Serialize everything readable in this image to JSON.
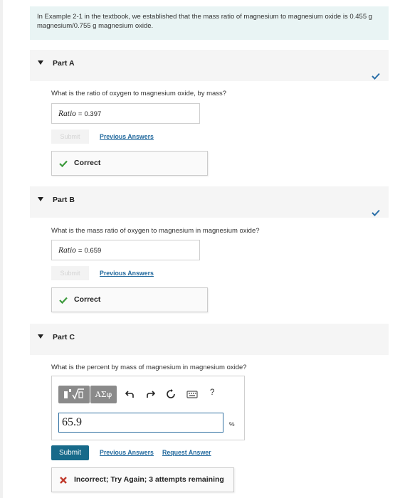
{
  "intro_text": "In Example 2-1 in the textbook, we established that the mass ratio of magnesium to magnesium oxide is 0.455 g magnesium/0.755 g magnesium oxide.",
  "colors": {
    "accent": "#176a8a",
    "link": "#236a9e",
    "correct": "#3c9a3c",
    "incorrect": "#c0392b",
    "check": "#2a6fa8"
  },
  "part_a": {
    "title": "Part A",
    "question": "What is the ratio of oxygen to magnesium oxide, by mass?",
    "answer_var": "Ratio",
    "answer_eq": "=",
    "answer_value": "0.397",
    "submit_label": "Submit",
    "previous_answers_label": "Previous Answers",
    "feedback": "Correct"
  },
  "part_b": {
    "title": "Part B",
    "question": "What is the mass ratio of oxygen to magnesium in magnesium oxide?",
    "answer_var": "Ratio",
    "answer_eq": "=",
    "answer_value": "0.659",
    "submit_label": "Submit",
    "previous_answers_label": "Previous Answers",
    "feedback": "Correct"
  },
  "part_c": {
    "title": "Part C",
    "question": "What is the percent by mass of magnesium in magnesium oxide?",
    "toolbar": {
      "templates_icon": "math-templates-icon",
      "symbols_label": "ΑΣφ",
      "undo_icon": "undo-icon",
      "redo_icon": "redo-icon",
      "reset_icon": "reset-icon",
      "keyboard_icon": "keyboard-icon",
      "help_label": "?"
    },
    "input_value": "65.9",
    "unit": "%",
    "submit_label": "Submit",
    "previous_answers_label": "Previous Answers",
    "request_answer_label": "Request Answer",
    "feedback": "Incorrect; Try Again; 3 attempts remaining"
  }
}
